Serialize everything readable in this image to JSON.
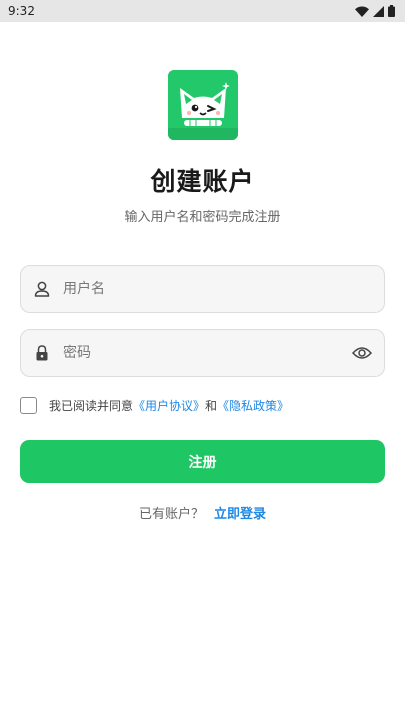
{
  "status_bar": {
    "time": "9:32"
  },
  "header": {
    "title": "创建账户",
    "subtitle": "输入用户名和密码完成注册"
  },
  "form": {
    "username_placeholder": "用户名",
    "username_value": "",
    "password_placeholder": "密码",
    "password_value": ""
  },
  "agreement": {
    "checked": false,
    "prefix": "我已阅读并同意",
    "user_agreement": "《用户协议》",
    "conjunction": "和",
    "privacy_policy": "《隐私政策》"
  },
  "register_button": "注册",
  "login_prompt": {
    "text": "已有账户？",
    "link": "立即登录"
  },
  "colors": {
    "accent": "#1fc764",
    "logo_bg": "#22c86a",
    "link": "#1e88e5"
  },
  "icons": {
    "username": "user-icon",
    "password": "lock-icon",
    "visibility": "eye-icon",
    "logo": "cat-logo-icon"
  }
}
